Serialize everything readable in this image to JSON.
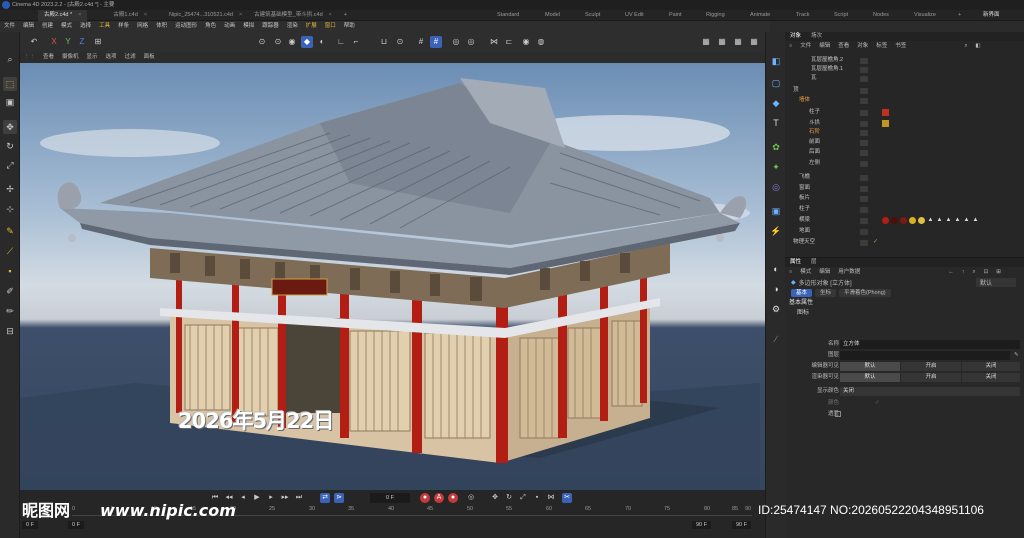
{
  "titlebar": {
    "title": "Cinema 4D 2023.2.2 - [古殿2.c4d *] - 主要"
  },
  "doc_tabs": [
    "古殿2.c4d *",
    "古殿1.c4d",
    "Nipic_25474...310521.c4d",
    "古建筑基础模型_带斗拱.c4d"
  ],
  "layout_tabs": [
    "Standard",
    "Model",
    "Sculpt",
    "UV Edit",
    "Paint",
    "Rigging",
    "Animate",
    "Track",
    "Script",
    "Nodes",
    "Visualize"
  ],
  "layout_right": "新界面",
  "menus": [
    "文件",
    "编辑",
    "创建",
    "模式",
    "选择",
    "工具",
    "样条",
    "网格",
    "体积",
    "运动图形",
    "角色",
    "动画",
    "模拟",
    "跟踪器",
    "渲染",
    "扩展",
    "窗口",
    "帮助"
  ],
  "menu_highlight": [
    "工具",
    "扩展",
    "窗口"
  ],
  "toolbar_axes": [
    "X",
    "Y",
    "Z"
  ],
  "viewport_menu": [
    "查看",
    "摄像机",
    "显示",
    "选项",
    "过滤",
    "面板"
  ],
  "viewport_stamp": "2026年5月22日",
  "timeline": {
    "current_frame": "0 F",
    "ticks": [
      "0",
      "5",
      "10",
      "15",
      "20",
      "25",
      "30",
      "35",
      "40",
      "45",
      "50",
      "55",
      "60",
      "65",
      "70",
      "75",
      "80",
      "85",
      "90"
    ],
    "start": "0 F",
    "start2": "0 F",
    "end": "90 F",
    "end2": "90 F"
  },
  "object_manager": {
    "tabs": [
      "对象",
      "场次"
    ],
    "menu": [
      "文件",
      "编辑",
      "查看",
      "对象",
      "标签",
      "书签"
    ],
    "rows": [
      {
        "name": "瓦层屋檐角.2"
      },
      {
        "name": "瓦层屋檐角.1"
      },
      {
        "name": "瓦"
      },
      {
        "name": "顶"
      },
      {
        "name": "墙体",
        "orange": true
      },
      {
        "name": "柱子"
      },
      {
        "name": "斗拱"
      },
      {
        "name": "石阶",
        "orange": true
      },
      {
        "name": "前面"
      },
      {
        "name": "后面"
      },
      {
        "name": "左侧"
      },
      {
        "name": "飞檐"
      },
      {
        "name": "窗面"
      },
      {
        "name": "板片"
      },
      {
        "name": "柱子"
      },
      {
        "name": "横梁"
      },
      {
        "name": "地面"
      },
      {
        "name": "物理天空"
      }
    ]
  },
  "attributes": {
    "tabs": [
      "属性",
      "层"
    ],
    "menu": [
      "模式",
      "编辑",
      "用户数据"
    ],
    "object_type": "多边形对象 [立方体]",
    "preset": "默认",
    "subtabs": [
      "基本",
      "坐标",
      "平滑着色(Phong)"
    ],
    "section": "基本属性",
    "subsection": "图标",
    "fields": {
      "name_label": "名称",
      "name_value": "立方体",
      "layer_label": "图层",
      "editor_vis_label": "编辑器可见",
      "render_vis_label": "渲染器可见",
      "vis_options": [
        "默认",
        "开启",
        "关闭"
      ],
      "display_color_label": "显示颜色",
      "display_color_value": "关闭",
      "color_label": "颜色",
      "xray_label": "透显"
    }
  },
  "watermarks": {
    "left": "昵图网",
    "url": "www.nipic.com",
    "id": "ID:25474147 NO:20260522204348951106"
  },
  "colors": {
    "accent": "#3a63b8",
    "highlight": "#e3b93a",
    "pillar": "#b21d14",
    "roof": "#8a93a0",
    "sky": "#a9bfd5"
  }
}
